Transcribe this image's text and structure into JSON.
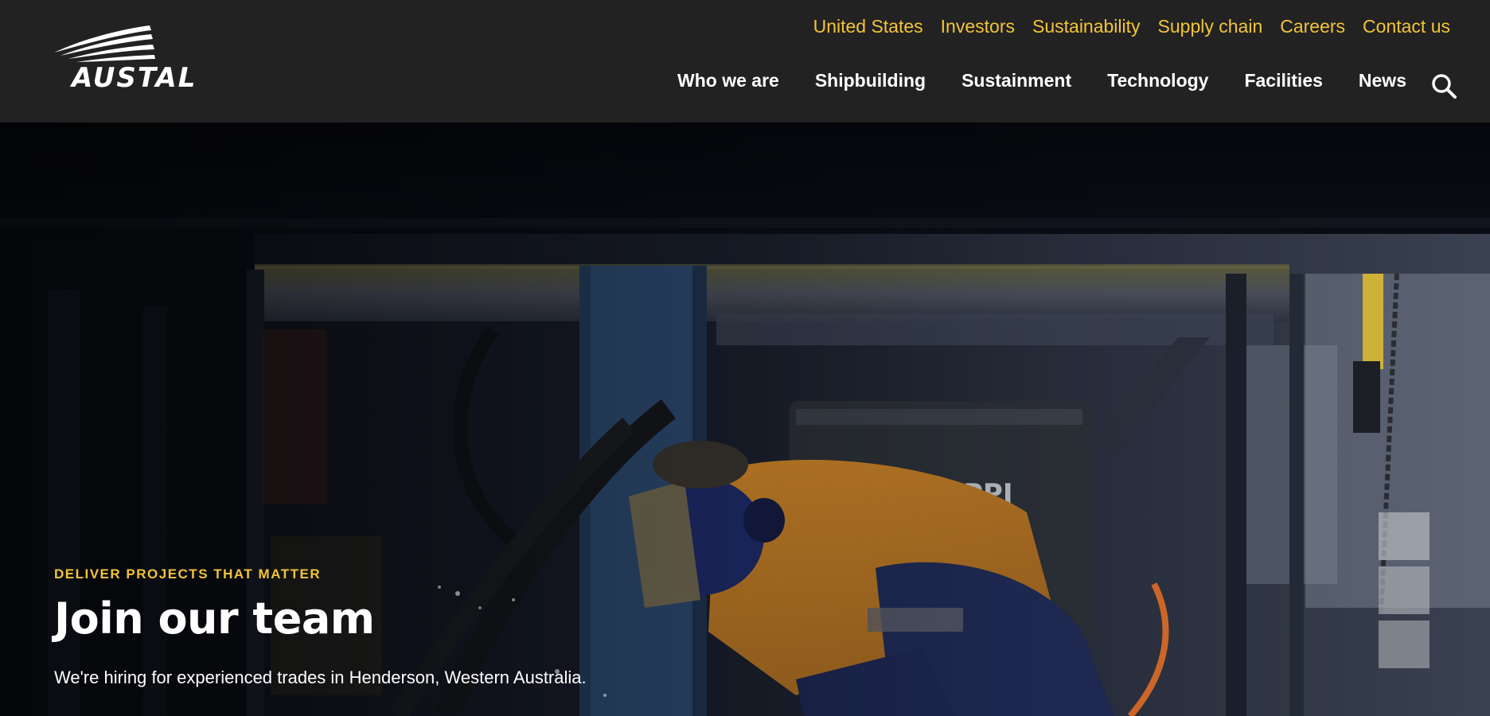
{
  "brand": {
    "name": "AUSTAL",
    "accent_color": "#f2c43a",
    "header_bg": "#222222"
  },
  "utility_nav": [
    {
      "label": "United States"
    },
    {
      "label": "Investors"
    },
    {
      "label": "Sustainability"
    },
    {
      "label": "Supply chain"
    },
    {
      "label": "Careers"
    },
    {
      "label": "Contact us"
    }
  ],
  "main_nav": [
    {
      "label": "Who we are"
    },
    {
      "label": "Shipbuilding"
    },
    {
      "label": "Sustainment"
    },
    {
      "label": "Technology"
    },
    {
      "label": "Facilities"
    },
    {
      "label": "News"
    }
  ],
  "search": {
    "icon": "search-icon"
  },
  "hero": {
    "eyebrow": "DELIVER PROJECTS THAT MATTER",
    "title": "Join our team",
    "subtitle": "We're hiring for experienced trades in Henderson, Western Australia."
  }
}
